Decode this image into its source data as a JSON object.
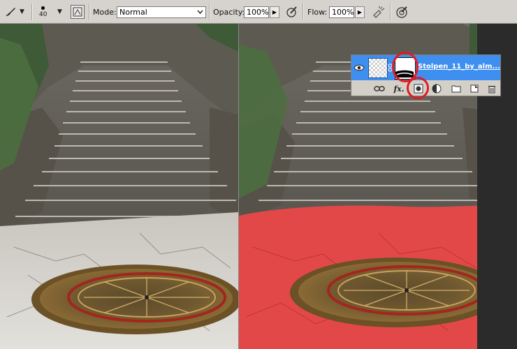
{
  "toolbar": {
    "brush_size": "40",
    "mode_label": "Mode:",
    "mode_value": "Normal",
    "opacity_label": "Opacity:",
    "opacity_value": "100%",
    "flow_label": "Flow:",
    "flow_value": "100%"
  },
  "layers_panel": {
    "layer_name": "Stolpen_11_by_alm...",
    "footer_icons": [
      "link-icon",
      "fx-icon",
      "add-mask-icon",
      "adjustment-icon",
      "new-group-icon",
      "new-layer-icon",
      "trash-icon"
    ],
    "selection_color": "#3e8ff0"
  },
  "annotations": {
    "highlight_color": "#e01b22"
  },
  "overlay": {
    "quick_mask_color": "#ef2b2b"
  }
}
